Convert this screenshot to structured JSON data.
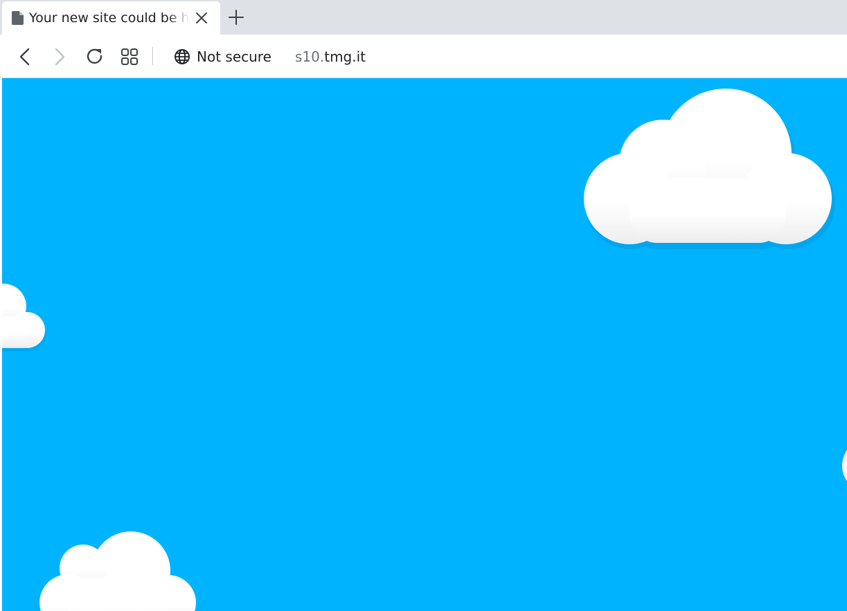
{
  "browser": {
    "tab": {
      "title": "Your new site could be here",
      "favicon": "document-icon"
    },
    "toolbar": {
      "back_icon": "back-arrow-icon",
      "forward_icon": "forward-arrow-icon",
      "reload_icon": "reload-icon",
      "apps_icon": "apps-grid-icon",
      "security_icon": "globe-icon",
      "security_label": "Not secure",
      "url_subdomain": "s10.",
      "url_domain": "tmg.it"
    }
  },
  "page": {
    "background_color": "#00b3ff",
    "decorations": [
      "cloud",
      "cloud",
      "cloud",
      "cloud"
    ]
  }
}
